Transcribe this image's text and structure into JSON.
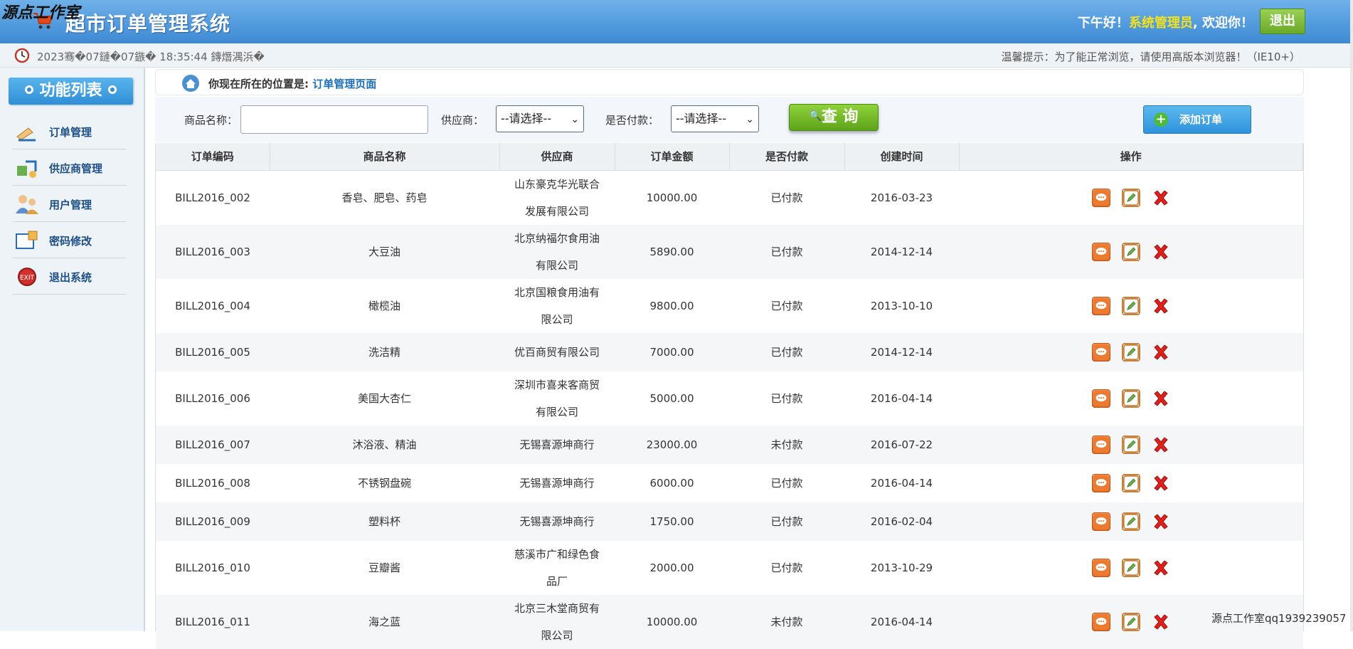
{
  "header": {
    "watermark": "源点工作室",
    "title": "超市订单管理系统",
    "greeting_prefix": "下午好！",
    "role": "系统管理员",
    "greeting_suffix": ", 欢迎你！",
    "logout_label": "退出"
  },
  "infobar": {
    "datetime": "2023骞�07鏈�07鏃� 18:35:44 鏄熸湡浜�",
    "tip": "温馨提示：为了能正常浏览，请使用高版本浏览器！（IE10+）"
  },
  "sidebar": {
    "heading": "功能列表",
    "items": [
      {
        "label": "订单管理",
        "icon": "order-icon"
      },
      {
        "label": "供应商管理",
        "icon": "supplier-icon"
      },
      {
        "label": "用户管理",
        "icon": "users-icon"
      },
      {
        "label": "密码修改",
        "icon": "password-icon"
      },
      {
        "label": "退出系统",
        "icon": "exit-icon"
      }
    ]
  },
  "breadcrumb": {
    "prefix": "你现在所在的位置是:",
    "current": "订单管理页面"
  },
  "search": {
    "product_label": "商品名称：",
    "product_value": "",
    "supplier_label": "供应商：",
    "supplier_selected": "--请选择--",
    "paid_label": "是否付款：",
    "paid_selected": "--请选择--",
    "query_label": "查 询",
    "add_label": "添加订单"
  },
  "table": {
    "headers": [
      "订单编码",
      "商品名称",
      "供应商",
      "订单金额",
      "是否付款",
      "创建时间",
      "操作"
    ],
    "rows": [
      {
        "code": "BILL2016_002",
        "product": "香皂、肥皂、药皂",
        "supplier": "山东豪克华光联合发展有限公司",
        "amount": "10000.00",
        "paid": "已付款",
        "date": "2016-03-23"
      },
      {
        "code": "BILL2016_003",
        "product": "大豆油",
        "supplier": "北京纳福尔食用油有限公司",
        "amount": "5890.00",
        "paid": "已付款",
        "date": "2014-12-14"
      },
      {
        "code": "BILL2016_004",
        "product": "橄榄油",
        "supplier": "北京国粮食用油有限公司",
        "amount": "9800.00",
        "paid": "已付款",
        "date": "2013-10-10"
      },
      {
        "code": "BILL2016_005",
        "product": "洗洁精",
        "supplier": "优百商贸有限公司",
        "amount": "7000.00",
        "paid": "已付款",
        "date": "2014-12-14"
      },
      {
        "code": "BILL2016_006",
        "product": "美国大杏仁",
        "supplier": "深圳市喜来客商贸有限公司",
        "amount": "5000.00",
        "paid": "已付款",
        "date": "2016-04-14"
      },
      {
        "code": "BILL2016_007",
        "product": "沐浴液、精油",
        "supplier": "无锡喜源坤商行",
        "amount": "23000.00",
        "paid": "未付款",
        "date": "2016-07-22"
      },
      {
        "code": "BILL2016_008",
        "product": "不锈钢盘碗",
        "supplier": "无锡喜源坤商行",
        "amount": "6000.00",
        "paid": "已付款",
        "date": "2016-04-14"
      },
      {
        "code": "BILL2016_009",
        "product": "塑料杯",
        "supplier": "无锡喜源坤商行",
        "amount": "1750.00",
        "paid": "已付款",
        "date": "2016-02-04"
      },
      {
        "code": "BILL2016_010",
        "product": "豆瓣酱",
        "supplier": "慈溪市广和绿色食品厂",
        "amount": "2000.00",
        "paid": "已付款",
        "date": "2013-10-29"
      },
      {
        "code": "BILL2016_011",
        "product": "海之蓝",
        "supplier": "北京三木堂商贸有限公司",
        "amount": "10000.00",
        "paid": "未付款",
        "date": "2016-04-14"
      }
    ]
  },
  "footer_watermark": "源点工作室qq1939239057"
}
